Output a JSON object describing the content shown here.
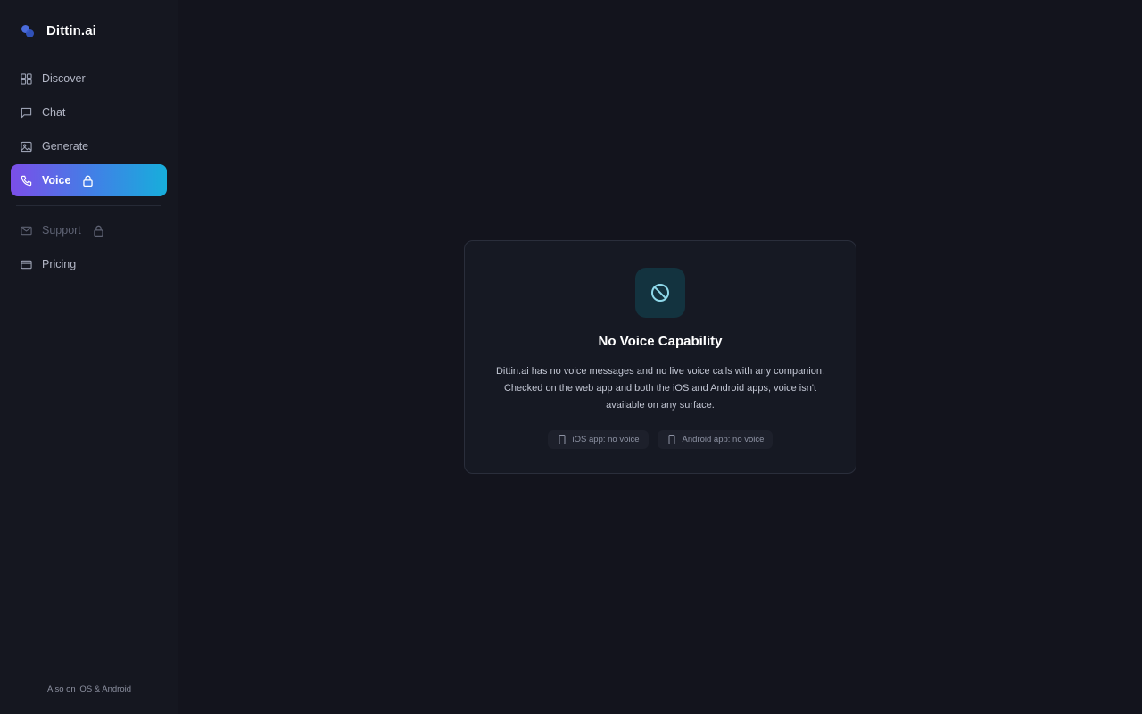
{
  "brand": {
    "name": "Dittin.ai"
  },
  "sidebar": {
    "items": [
      {
        "label": "Discover",
        "icon": "grid-icon"
      },
      {
        "label": "Chat",
        "icon": "chat-bubble-icon"
      },
      {
        "label": "Generate",
        "icon": "image-icon"
      },
      {
        "label": "Voice",
        "icon": "phone-icon",
        "active": true,
        "locked": true
      },
      {
        "label": "Support",
        "icon": "mail-icon",
        "disabled": true,
        "locked": true
      },
      {
        "label": "Pricing",
        "icon": "credit-card-icon"
      }
    ],
    "footer": "Also on iOS & Android"
  },
  "card": {
    "icon": "prohibited-icon",
    "title": "No Voice Capability",
    "description": "Dittin.ai has no voice messages and no live voice calls with any companion. Checked on the web app and both the iOS and Android apps, voice isn't available on any surface.",
    "chips": [
      {
        "label": "iOS app: no voice",
        "icon": "phone-device-icon"
      },
      {
        "label": "Android app: no voice",
        "icon": "phone-device-icon"
      }
    ]
  },
  "colors": {
    "background": "#13141d",
    "sidebar": "#151720",
    "accent_gradient_start": "#7b4ee8",
    "accent_gradient_end": "#17aedb",
    "icon_teal": "#8fd9ea"
  }
}
